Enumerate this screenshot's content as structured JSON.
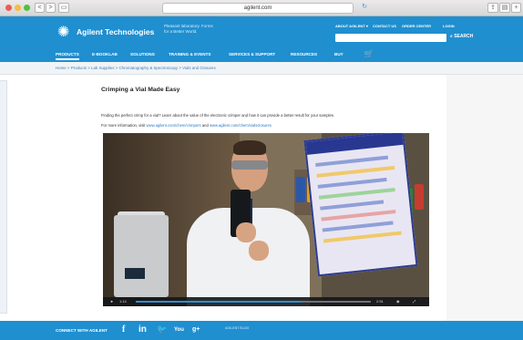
{
  "browser": {
    "url": "agilent.com",
    "back_label": "<",
    "forward_label": ">",
    "tab_label": "▭",
    "share_label": "⇪",
    "reader_label": "▤",
    "newtab_label": "+"
  },
  "header": {
    "brand": "Agilent Technologies",
    "tagline": "Pleasant laboratory. Forms for a Better World.",
    "util_links": [
      "ABOUT AGILENT ▾",
      "CONTACT US",
      "ORDER CENTER",
      "LOGIN"
    ],
    "search_label": "SEARCH"
  },
  "mainnav": {
    "items": [
      "PRODUCTS",
      "E-BOOKLAB",
      "SOLUTIONS",
      "TRAINING & EVENTS",
      "SERVICES & SUPPORT",
      "RESOURCES",
      "BUY"
    ]
  },
  "breadcrumb": "Home  >  Products  >  Lab Supplies  >  Chromatography & Spectroscopy  >  Vials and Closures",
  "main": {
    "title": "Crimping a Vial Made Easy",
    "intro": "Finding the perfect crimp for a vial? Learn about the value of the electronic crimper and how it can provide a better result for your samples.",
    "info_prefix": "For more information, visit",
    "info_link1": "www.agilent.com/chem/crimpers",
    "info_mid": "and",
    "info_link2": "www.agilent.com/chem/vialsclosures"
  },
  "video": {
    "time_current": "1:14",
    "time_total": "2:51",
    "play_icon": "►",
    "volume_icon": "◉",
    "fullscreen_icon": "⤢",
    "progress": 0.7
  },
  "footer": {
    "connect_label": "CONNECT WITH AGILENT",
    "social_icons": [
      "f",
      "in",
      "🐦",
      "You",
      "g+"
    ],
    "small_text": "AGILENT\nBLOG"
  },
  "colors": {
    "brand_blue": "#1f8fd0",
    "link_blue": "#2c7ac0",
    "video_progress": "#2b8fd3"
  }
}
